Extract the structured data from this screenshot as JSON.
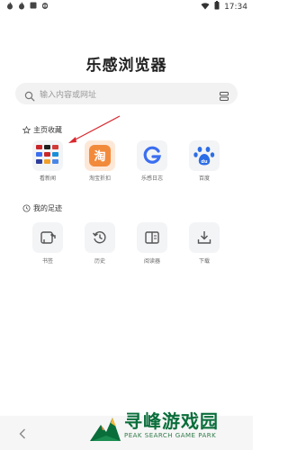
{
  "status_bar": {
    "time": "17:34",
    "left_icons": [
      "flame-icon",
      "flame-icon",
      "square-icon",
      "bug-icon"
    ],
    "right_icons": [
      "wifi-icon",
      "battery-icon"
    ]
  },
  "app": {
    "title": "乐感浏览器"
  },
  "search": {
    "placeholder": "输入内容或网址"
  },
  "favorites": {
    "title": "主页收藏",
    "items": [
      {
        "label": "看新闻",
        "icon": "news-grid-icon"
      },
      {
        "label": "淘宝折扣",
        "icon": "taobao-icon"
      },
      {
        "label": "乐感日志",
        "icon": "g-logo-icon"
      },
      {
        "label": "百度",
        "icon": "baidu-paw-icon"
      }
    ]
  },
  "footprints": {
    "title": "我的足迹",
    "items": [
      {
        "label": "书签",
        "icon": "bookmark-icon"
      },
      {
        "label": "历史",
        "icon": "history-icon"
      },
      {
        "label": "阅读器",
        "icon": "book-icon"
      },
      {
        "label": "下载",
        "icon": "download-icon"
      }
    ]
  },
  "nav": {
    "back_icon": "chevron-left-icon"
  },
  "watermark": {
    "cn": "寻峰游戏园",
    "en": "PEAK SEARCH GAME PARK"
  },
  "colors": {
    "accent_orange": "#f28a3c",
    "accent_blue": "#3b6ef0",
    "baidu_blue": "#2b6de5",
    "watermark_green": "#0a6e3b",
    "arrow_red": "#d9272e"
  }
}
